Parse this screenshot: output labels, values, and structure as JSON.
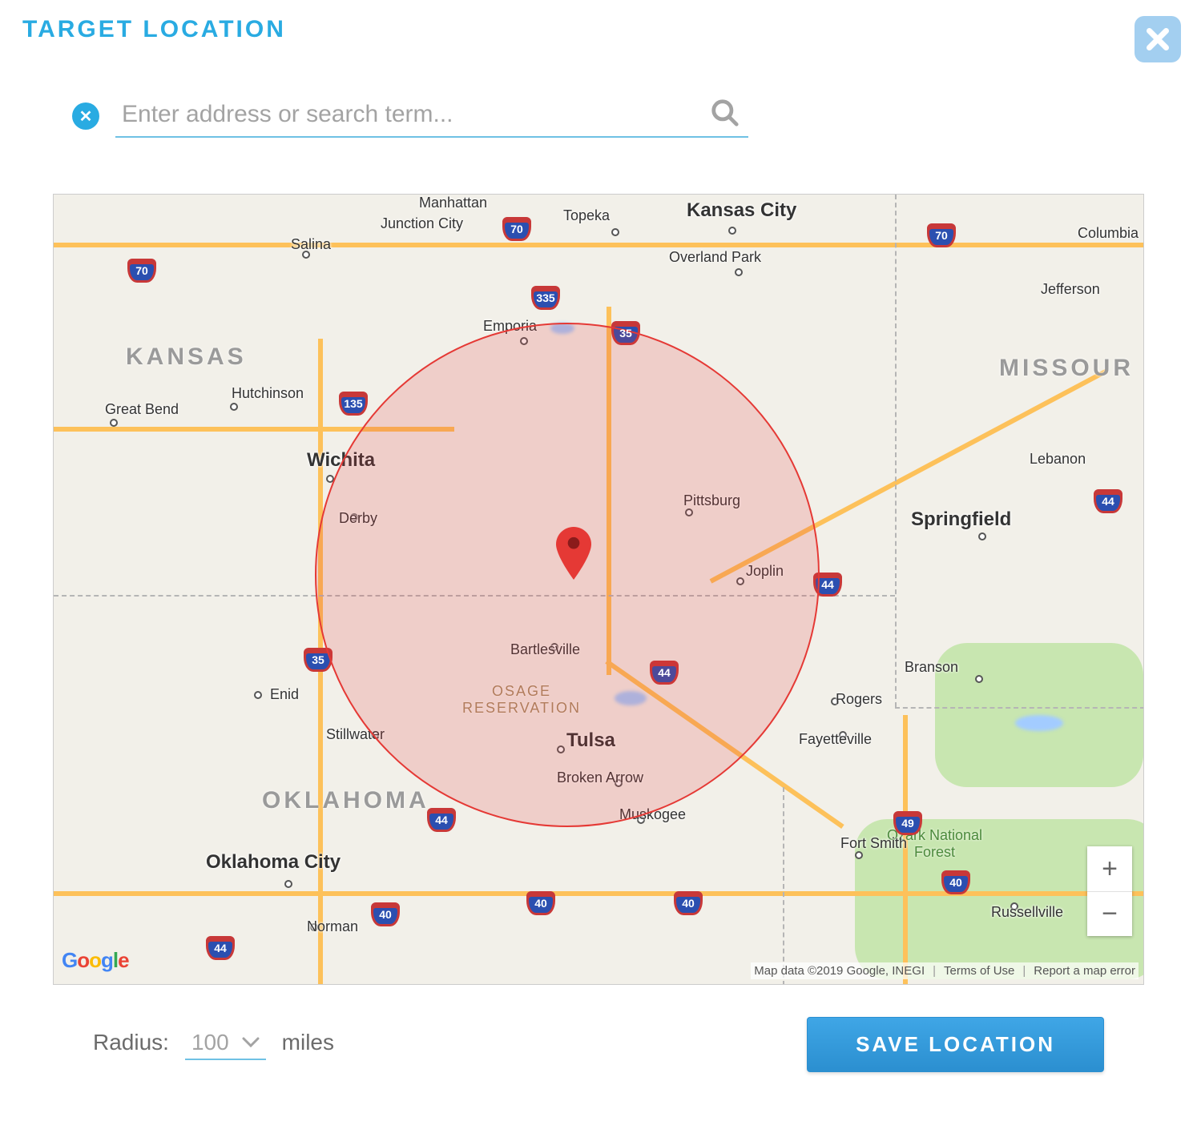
{
  "title": "TARGET LOCATION",
  "search": {
    "placeholder": "Enter address or search term...",
    "value": ""
  },
  "radius": {
    "label": "Radius:",
    "value": "100",
    "unit": "miles"
  },
  "buttons": {
    "save": "SAVE LOCATION"
  },
  "map": {
    "attribution": "Map data ©2019 Google, INEGI",
    "terms": "Terms of Use",
    "report": "Report a map error",
    "logo": "Google",
    "states": {
      "kansas": "KANSAS",
      "oklahoma": "OKLAHOMA",
      "missouri": "MISSOUR"
    },
    "poi": {
      "ozark": "Ozark National\nForest",
      "osage": "OSAGE\nRESERVATION"
    },
    "cities": {
      "kansas_city": "Kansas City",
      "overland_park": "Overland Park",
      "topeka": "Topeka",
      "manhattan": "Manhattan",
      "junction_city": "Junction City",
      "salina": "Salina",
      "great_bend": "Great Bend",
      "hutchinson": "Hutchinson",
      "wichita": "Wichita",
      "derby": "Derby",
      "emporia": "Emporia",
      "pittsburg": "Pittsburg",
      "joplin": "Joplin",
      "springfield": "Springfield",
      "columbia": "Columbia",
      "jefferson": "Jefferson",
      "lebanon": "Lebanon",
      "branson": "Branson",
      "rogers": "Rogers",
      "fayetteville": "Fayetteville",
      "fort_smith": "Fort Smith",
      "russellville": "Russellville",
      "bartlesville": "Bartlesville",
      "tulsa": "Tulsa",
      "broken_arrow": "Broken Arrow",
      "muskogee": "Muskogee",
      "stillwater": "Stillwater",
      "enid": "Enid",
      "oklahoma_city": "Oklahoma City",
      "norman": "Norman"
    },
    "shields": {
      "i70_a": "70",
      "i70_b": "70",
      "i335": "335",
      "i35_a": "35",
      "i35_b": "35",
      "i135": "135",
      "i44_a": "44",
      "i44_b": "44",
      "i44_c": "44",
      "i44_d": "44",
      "i44_e": "44",
      "i40_a": "40",
      "i40_b": "40",
      "i40_c": "40",
      "i40_d": "40",
      "i49": "49"
    }
  }
}
